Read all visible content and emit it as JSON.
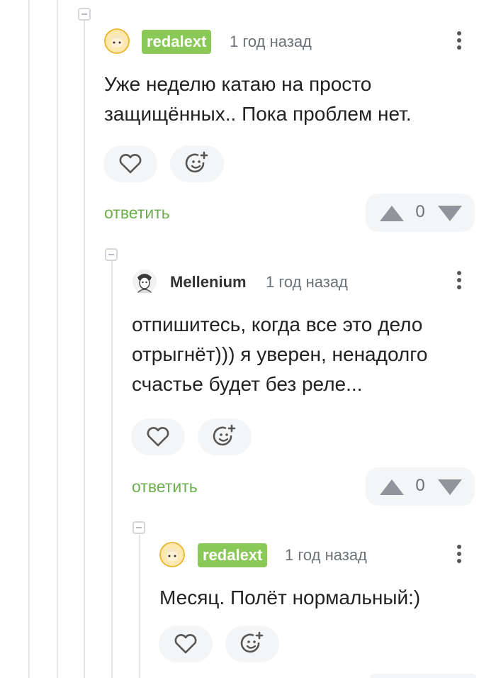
{
  "comments": [
    {
      "username": "redalext",
      "time": "1 год назад",
      "text_lines": [
        "Уже неделю катаю на просто",
        "защищённых.. Пока проблем нет."
      ],
      "reply_label": "ответить",
      "rating": "0"
    },
    {
      "username": "Mellenium",
      "time": "1 год назад",
      "text_lines": [
        "отпишитесь, когда все это дело",
        "отрыгнёт))) я уверен, ненадолго",
        "счастье будет без реле..."
      ],
      "reply_label": "ответить",
      "rating": "0"
    },
    {
      "username": "redalext",
      "time": "1 год назад",
      "text_lines": [
        "Месяц. Полёт нормальный:)"
      ]
    }
  ],
  "icons": {
    "like": "heart-icon",
    "reaction": "add-emoji-icon",
    "upvote": "arrow-up-icon",
    "downvote": "arrow-down-icon",
    "more": "more-vertical-icon",
    "collapse": "collapse-icon"
  },
  "colors": {
    "accent_green": "#8ac858",
    "reply_green": "#6ab04c"
  }
}
